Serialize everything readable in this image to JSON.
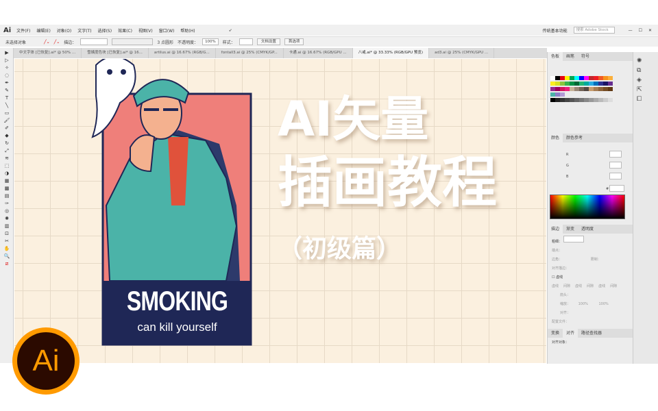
{
  "menubar": {
    "logo": "Ai",
    "items": [
      "文件(F)",
      "编辑(E)",
      "对象(O)",
      "文字(T)",
      "选择(S)",
      "效果(C)",
      "视图(V)",
      "窗口(W)",
      "帮助(H)"
    ],
    "workspace": "传统基本功能",
    "search_placeholder": "搜索 Adobe Stock"
  },
  "control": {
    "selection": "未选择对象",
    "stroke_label": "描边：",
    "brush": "3 点圆形",
    "opacity_label": "不透明度：",
    "opacity": "100%",
    "style_label": "样式：",
    "doc_setup": "文档设置",
    "prefs": "首选项"
  },
  "tabs": [
    "中文字体 [已恢复].ai* @ 50% ...",
    "雪姨度色块 [已恢复].ai* @ 16...",
    "artilus.ai @ 16.67% (RGB/G...",
    "fontall3.ai @ 25% (CMYK/GP...",
    "卡通.ai @ 16.67% (RGB/GPU ...",
    "八戒.ai* @ 33.33% (RGB/GPU 预览)",
    "ad3.ai @ 25% (CMYK/GPU ..."
  ],
  "active_tab": 5,
  "artwork": {
    "headline": "SMOKING",
    "tagline": "can kill yourself",
    "title1": "AI矢量",
    "title2": "插画教程",
    "title3": "（初级篇）",
    "logo": "Ai"
  },
  "panels": {
    "swatch_tabs": [
      "色板",
      "画笔",
      "符号"
    ],
    "color_tabs": [
      "颜色",
      "颜色参考"
    ],
    "rgb": [
      "R",
      "G",
      "B"
    ],
    "hash": "#",
    "stroke_tabs": [
      "描边",
      "渐变",
      "透明度"
    ],
    "weight_label": "粗细：",
    "cap": "端点：",
    "corner": "边角：",
    "limit": "限制：",
    "align_stroke": "对齐描边：",
    "dashed": "虚线",
    "dash_labels": [
      "虚线",
      "间隙",
      "虚线",
      "间隙",
      "虚线",
      "间隙"
    ],
    "arrow": "箭头：",
    "scale": "缩放：",
    "scale_vals": [
      "100%",
      "100%"
    ],
    "align": "对齐：",
    "profile": "配置文件：",
    "bottom_tabs": [
      "变换",
      "对齐",
      "路径查找器"
    ],
    "align_to": "对齐对象："
  },
  "colors": {
    "accent": "#ff9a00",
    "navy": "#1f2756",
    "pink": "#ef7f7a",
    "teal": "#4bb3a8",
    "canvas": "#fbf0df"
  }
}
